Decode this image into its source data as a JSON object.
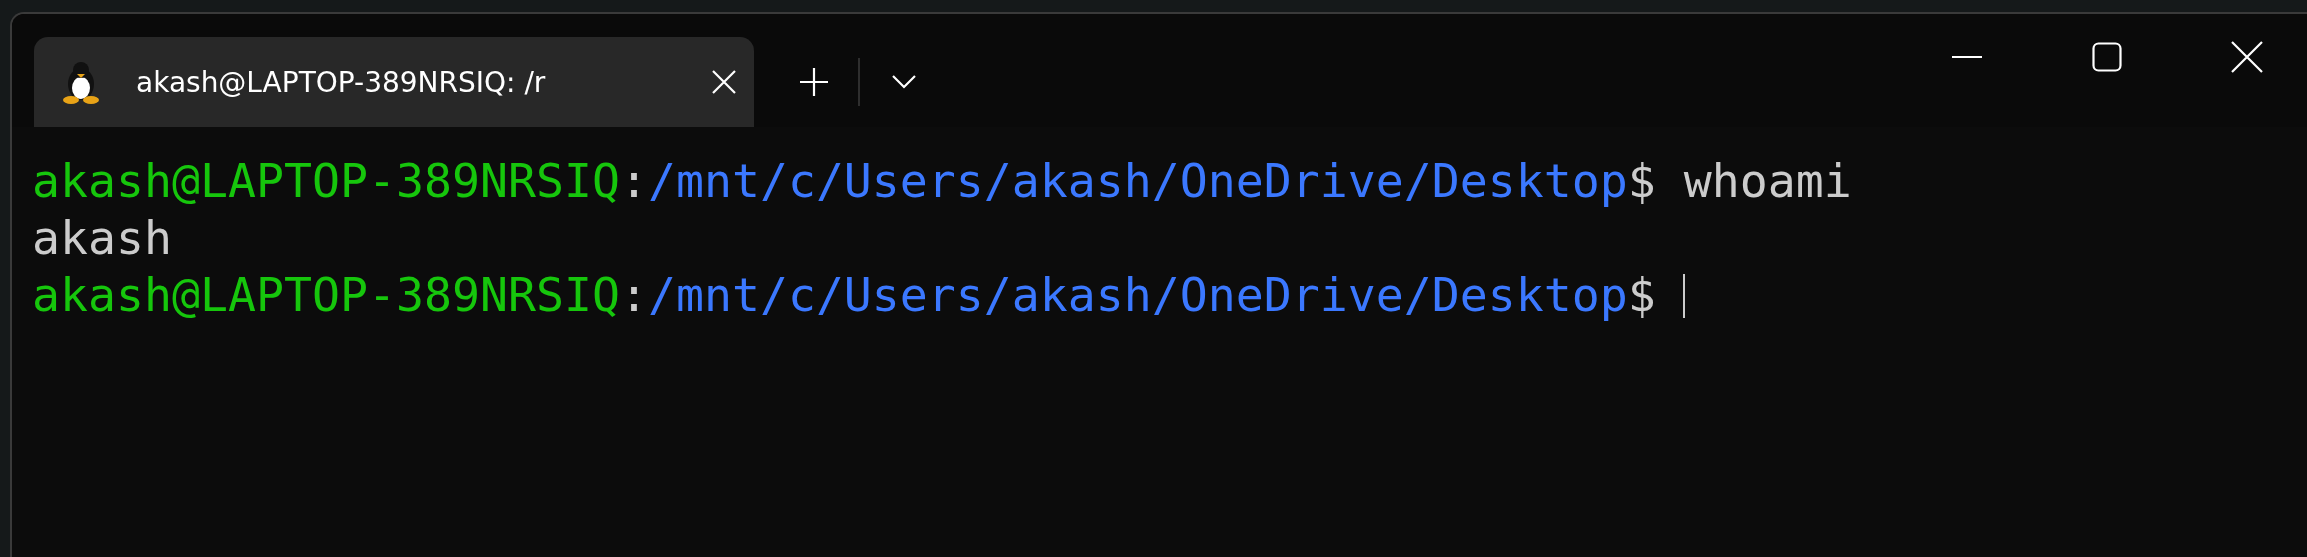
{
  "tabs": [
    {
      "title": "akash@LAPTOP-389NRSIQ: /r",
      "selected": true
    }
  ],
  "terminal": {
    "lines": [
      {
        "segments": [
          {
            "kind": "user",
            "text": "akash@LAPTOP-389NRSIQ"
          },
          {
            "kind": "plain",
            "text": ":"
          },
          {
            "kind": "path",
            "text": "/mnt/c/Users/akash/OneDrive/Desktop"
          },
          {
            "kind": "plain",
            "text": "$ whoami"
          }
        ],
        "cursor": false
      },
      {
        "segments": [
          {
            "kind": "plain",
            "text": "akash"
          }
        ],
        "cursor": false
      },
      {
        "segments": [
          {
            "kind": "user",
            "text": "akash@LAPTOP-389NRSIQ"
          },
          {
            "kind": "plain",
            "text": ":"
          },
          {
            "kind": "path",
            "text": "/mnt/c/Users/akash/OneDrive/Desktop"
          },
          {
            "kind": "plain",
            "text": "$"
          }
        ],
        "cursor": true
      }
    ]
  }
}
